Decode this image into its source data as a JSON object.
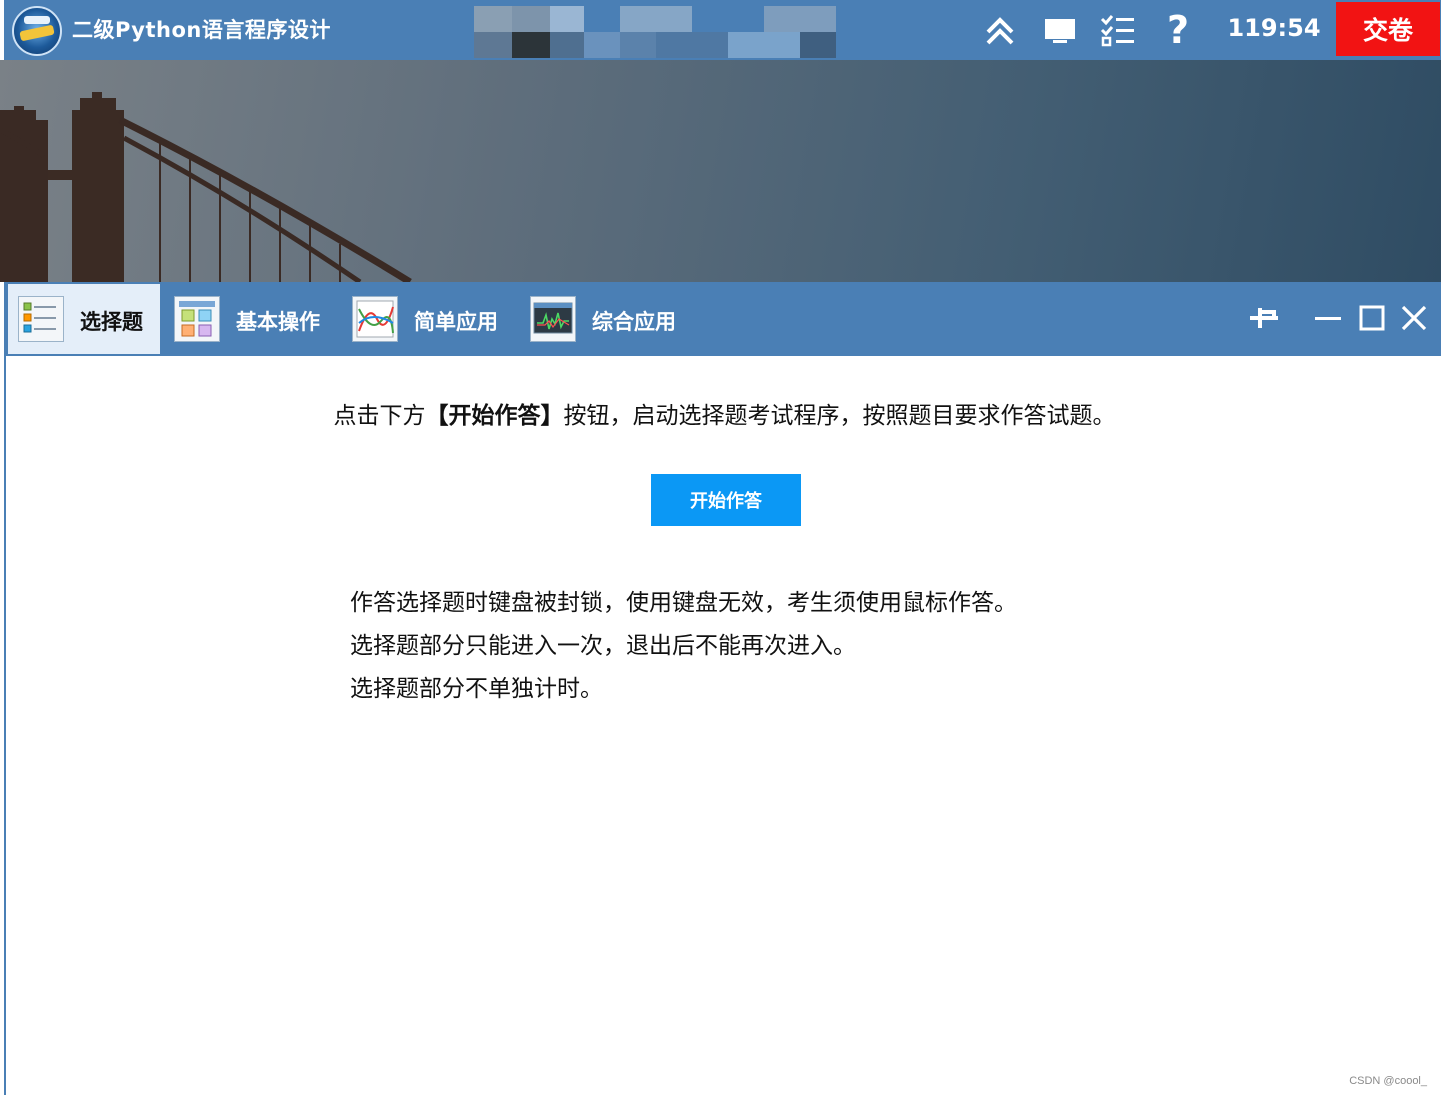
{
  "titlebar": {
    "app_title": "二级Python语言程序设计",
    "timer": "119:54",
    "submit_label": "交卷",
    "help_label": "?",
    "icons": [
      "collapse-up-icon",
      "monitor-icon",
      "checklist-icon",
      "help-icon"
    ],
    "accent_color": "#4a7fb5",
    "submit_color": "#f21313"
  },
  "tabs": [
    {
      "label": "选择题",
      "icon": "choice-question-icon",
      "active": true
    },
    {
      "label": "基本操作",
      "icon": "basic-operation-icon",
      "active": false
    },
    {
      "label": "简单应用",
      "icon": "simple-application-icon",
      "active": false
    },
    {
      "label": "综合应用",
      "icon": "comprehensive-application-icon",
      "active": false
    }
  ],
  "window_controls": [
    "pin-icon",
    "minimize-icon",
    "maximize-icon",
    "close-icon"
  ],
  "content": {
    "instruction_prefix": "点击下方",
    "instruction_emphasis": "【开始作答】",
    "instruction_suffix": "按钮，启动选择题考试程序，按照题目要求作答试题。",
    "start_button_label": "开始作答",
    "start_button_color": "#0b98f5",
    "notes": [
      "作答选择题时键盘被封锁，使用键盘无效，考生须使用鼠标作答。",
      "选择题部分只能进入一次，退出后不能再次进入。",
      "选择题部分不单独计时。"
    ]
  },
  "watermark": "CSDN @coool_"
}
